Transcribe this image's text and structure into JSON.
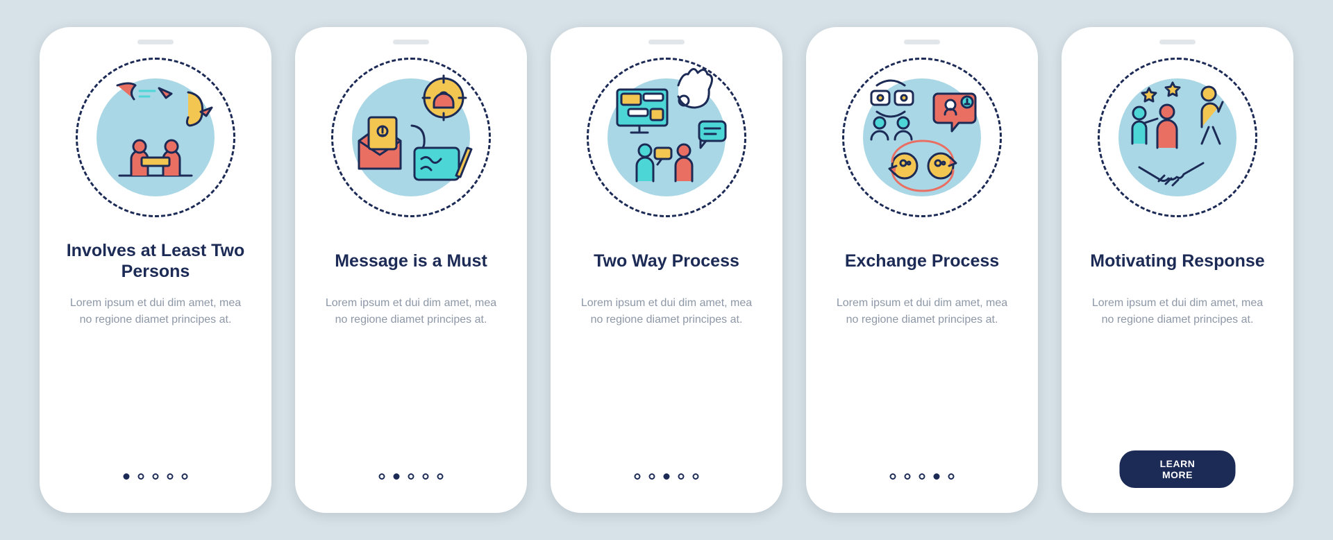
{
  "colors": {
    "stroke": "#1c2a56",
    "blue": "#aad7e6",
    "cyan": "#4cd6d6",
    "red": "#e96f63",
    "yellow": "#f2c651",
    "bg": "#d6e2e8"
  },
  "cta_label": "LEARN MORE",
  "cards": [
    {
      "title": "Involves at Least Two Persons",
      "desc": "Lorem ipsum et dui dim amet, mea no regione diamet principes at.",
      "icon": "two-persons-icon",
      "active_index": 0
    },
    {
      "title": "Message is a Must",
      "desc": "Lorem ipsum et dui dim amet, mea no regione diamet principes at.",
      "icon": "message-icon",
      "active_index": 1
    },
    {
      "title": "Two Way Process",
      "desc": "Lorem ipsum et dui dim amet, mea no regione diamet principes at.",
      "icon": "two-way-process-icon",
      "active_index": 2
    },
    {
      "title": "Exchange Process",
      "desc": "Lorem ipsum et dui dim amet, mea no regione diamet principes at.",
      "icon": "exchange-process-icon",
      "active_index": 3
    },
    {
      "title": "Motivating Response",
      "desc": "Lorem ipsum et dui dim amet, mea no regione diamet principes at.",
      "icon": "motivating-response-icon",
      "active_index": 4
    }
  ]
}
